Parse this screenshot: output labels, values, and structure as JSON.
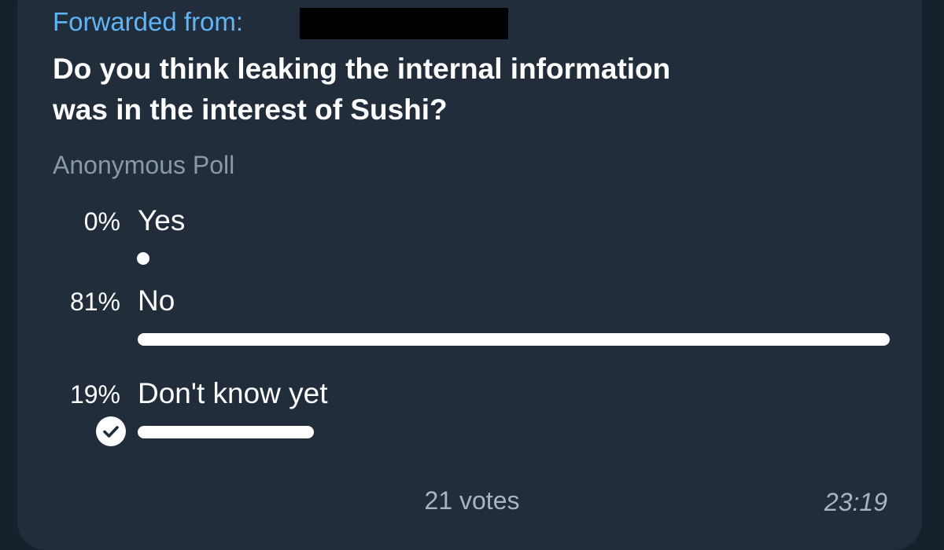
{
  "message": {
    "forwarded_label": "Forwarded from:",
    "question_line1": "Do you think leaking the internal information",
    "question_line2": "was in the interest of Sushi?",
    "poll_type": "Anonymous Poll",
    "options": [
      {
        "percent": "0%",
        "label": "Yes",
        "fraction": 0.0,
        "selected": false
      },
      {
        "percent": "81%",
        "label": "No",
        "fraction": 0.81,
        "selected": false
      },
      {
        "percent": "19%",
        "label": "Don't know yet",
        "fraction": 0.19,
        "selected": true
      }
    ],
    "votes": "21 votes",
    "time": "23:19"
  },
  "colors": {
    "background": "#17212b",
    "bubble": "#212d3b",
    "accent": "#5eb5f7",
    "text": "#ffffff",
    "muted": "#8b98a6"
  }
}
